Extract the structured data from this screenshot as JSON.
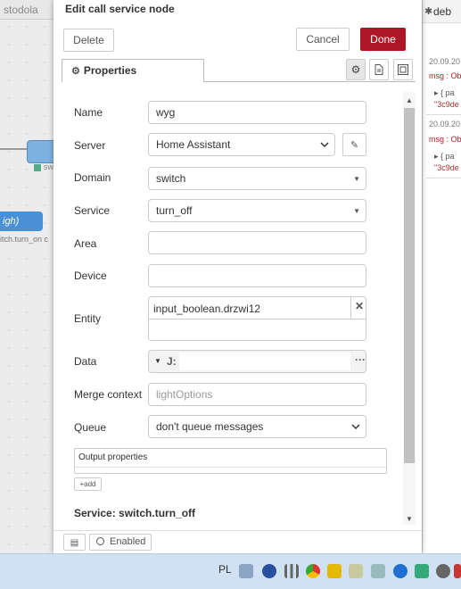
{
  "background": {
    "workspace_tab": "stodola",
    "node_a_label": "sw",
    "node_b_label": "igh)",
    "node_b_sublabel": "itch.turn_on c"
  },
  "sidebar": {
    "tab_label": "deb",
    "entries": [
      {
        "date": "20.09.20",
        "msg": "msg : Ob",
        "obj": "▸ { pa",
        "str": "\"3c9de"
      },
      {
        "date": "20.09.20",
        "msg": "msg : Ob",
        "obj": "▸ { pa",
        "str": "\"3c9de"
      }
    ]
  },
  "dialog": {
    "title": "Edit call service node",
    "delete_label": "Delete",
    "cancel_label": "Cancel",
    "done_label": "Done",
    "tab_properties": "Properties",
    "fields": {
      "name_label": "Name",
      "name_value": "wyg",
      "server_label": "Server",
      "server_value": "Home Assistant",
      "domain_label": "Domain",
      "domain_value": "switch",
      "service_label": "Service",
      "service_value": "turn_off",
      "area_label": "Area",
      "area_value": "",
      "device_label": "Device",
      "device_value": "",
      "entity_label": "Entity",
      "entity_chip": "input_boolean.drzwi12",
      "data_label": "Data",
      "data_type": "J:",
      "merge_label": "Merge context",
      "merge_placeholder": "lightOptions",
      "queue_label": "Queue",
      "queue_value": "don't queue messages",
      "output_properties_label": "Output properties",
      "add_label": "add"
    },
    "service_heading": "Service: switch.turn_off",
    "footer_enabled": "Enabled"
  },
  "taskbar": {
    "language": "PL"
  }
}
